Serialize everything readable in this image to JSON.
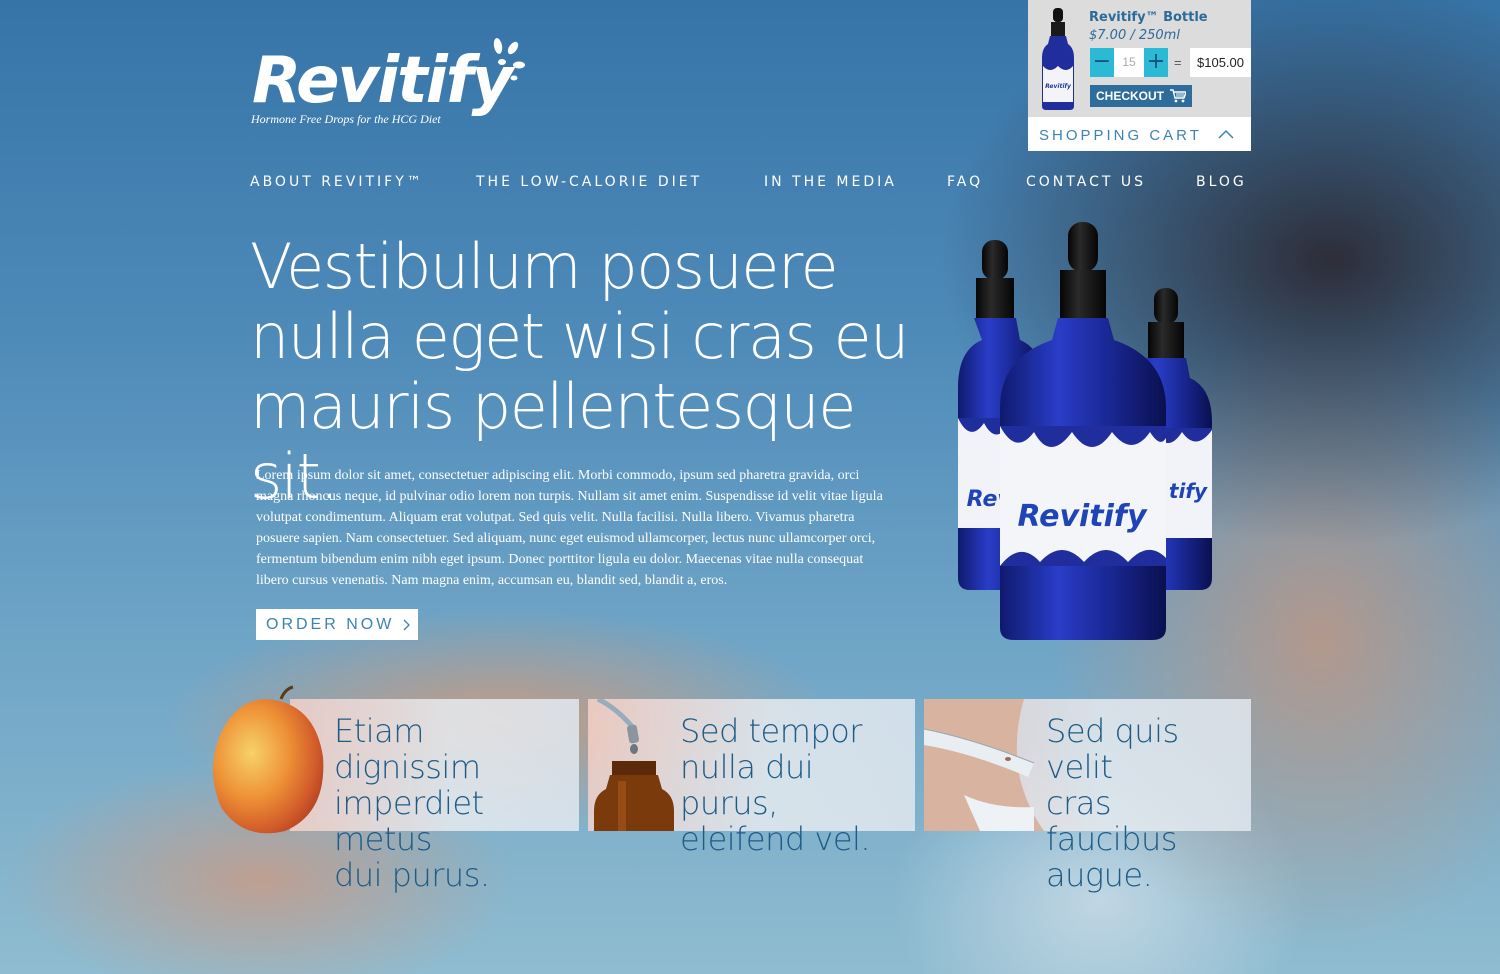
{
  "brand": {
    "name": "Revitify",
    "tagline": "Hormone Free Drops for the HCG Diet"
  },
  "cart": {
    "product_name": "Revitify™ Bottle",
    "price": "$7.00 / 250ml",
    "quantity": "15",
    "equals": "=",
    "total": "$105.00",
    "checkout_label": "CHECKOUT",
    "bar_label": "SHOPPING CART",
    "minus": "−",
    "plus": "+"
  },
  "nav": {
    "items": [
      {
        "label": "ABOUT REVITIFY™"
      },
      {
        "label": "THE LOW-CALORIE DIET"
      },
      {
        "label": "IN THE MEDIA"
      },
      {
        "label": "FAQ"
      },
      {
        "label": "CONTACT US"
      },
      {
        "label": "BLOG"
      }
    ]
  },
  "hero": {
    "headline_lines": [
      "Vestibulum posuere",
      "nulla eget wisi cras eu",
      "mauris pellentesque sit."
    ],
    "body": "Lorem ipsum dolor sit amet, consectetuer adipiscing elit. Morbi commodo, ipsum sed pharetra gravida, orci magna rhoncus neque, id pulvinar odio lorem non turpis. Nullam sit amet enim. Suspendisse id velit vitae ligula volutpat condimentum. Aliquam erat volutpat. Sed quis velit. Nulla facilisi. Nulla libero. Vivamus pharetra posuere sapien. Nam consectetuer. Sed aliquam, nunc eget euismod ullamcorper, lectus nunc ullamcorper orci, fermentum bibendum enim nibh eget ipsum. Donec porttitor ligula eu dolor. Maecenas vitae nulla consequat libero cursus venenatis. Nam magna enim, accumsan eu, blandit sed, blandit a, eros.",
    "cta_label": "ORDER NOW",
    "bottle_label": "Revitify"
  },
  "features": [
    {
      "lines": [
        "Etiam dignissim",
        "imperdiet metus",
        "dui purus."
      ]
    },
    {
      "lines": [
        "Sed tempor",
        "nulla dui purus,",
        "eleifend vel."
      ]
    },
    {
      "lines": [
        "Sed quis velit",
        "cras faucibus",
        "augue."
      ]
    }
  ],
  "colors": {
    "accent": "#2bbad6",
    "brand_blue": "#2e6c9c",
    "cart_bg": "#dcdcdc"
  }
}
